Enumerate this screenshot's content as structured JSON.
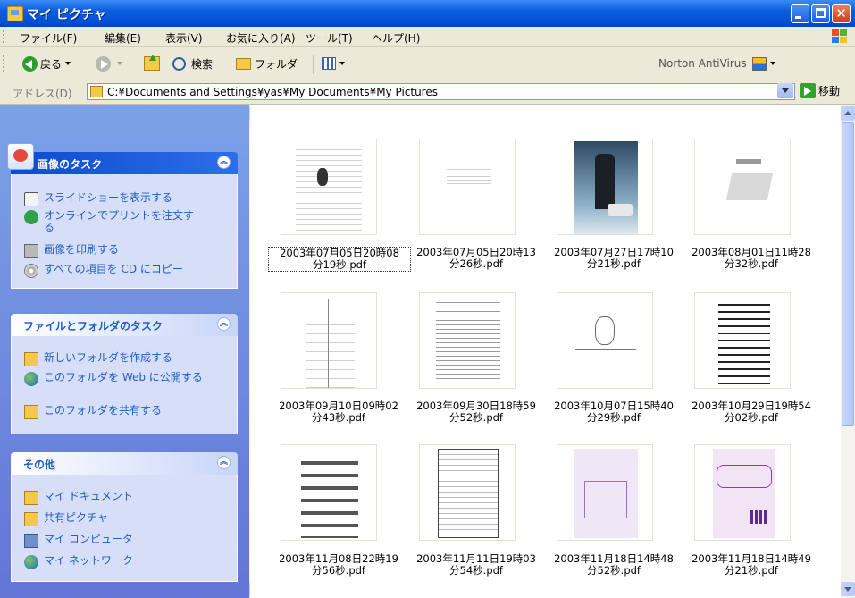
{
  "window": {
    "title": "マイ ピクチャ"
  },
  "menu": [
    "ファイル(F)",
    "編集(E)",
    "表示(V)",
    "お気に入り(A)",
    "ツール(T)",
    "ヘルプ(H)"
  ],
  "toolbar": {
    "back": "戻る",
    "search": "検索",
    "folders": "フォルダ",
    "norton": "Norton AntiVirus"
  },
  "address": {
    "label": "アドレス(D)",
    "path": "C:¥Documents and Settings¥yas¥My Documents¥My Pictures",
    "go": "移動"
  },
  "panels": [
    {
      "title": "画像のタスク",
      "items": [
        {
          "label": "スライドショーを表示する",
          "icon": "slideshow-icon"
        },
        {
          "label": "オンラインでプリントを注文する",
          "icon": "online-print-icon"
        },
        {
          "label": "画像を印刷する",
          "icon": "printer-icon"
        },
        {
          "label": "すべての項目を CD にコピー",
          "icon": "cd-icon"
        }
      ]
    },
    {
      "title": "ファイルとフォルダのタスク",
      "items": [
        {
          "label": "新しいフォルダを作成する",
          "icon": "new-folder-icon"
        },
        {
          "label": "このフォルダを Web に公開する",
          "icon": "web-publish-icon"
        },
        {
          "label": "このフォルダを共有する",
          "icon": "share-folder-icon"
        }
      ]
    },
    {
      "title": "その他",
      "items": [
        {
          "label": "マイ ドキュメント",
          "icon": "my-documents-icon"
        },
        {
          "label": "共有ピクチャ",
          "icon": "shared-pictures-icon"
        },
        {
          "label": "マイ コンピュータ",
          "icon": "my-computer-icon"
        },
        {
          "label": "マイ ネットワーク",
          "icon": "my-network-icon"
        }
      ]
    }
  ],
  "files": [
    {
      "line1": "2003年07月05日20時08",
      "line2": "分19秒.pdf",
      "selected": true,
      "kind": "form"
    },
    {
      "line1": "2003年07月05日20時13",
      "line2": "分26秒.pdf",
      "selected": false,
      "kind": "text"
    },
    {
      "line1": "2003年07月27日17時10",
      "line2": "分21秒.pdf",
      "selected": false,
      "kind": "poster"
    },
    {
      "line1": "2003年08月01日11時28",
      "line2": "分32秒.pdf",
      "selected": false,
      "kind": "scanner"
    },
    {
      "line1": "2003年09月10日09時02",
      "line2": "分43秒.pdf",
      "selected": false,
      "kind": "drawing"
    },
    {
      "line1": "2003年09月30日18時59",
      "line2": "分52秒.pdf",
      "selected": false,
      "kind": "form"
    },
    {
      "line1": "2003年10月07日15時40",
      "line2": "分29秒.pdf",
      "selected": false,
      "kind": "sketch"
    },
    {
      "line1": "2003年10月29日19時54",
      "line2": "分02秒.pdf",
      "selected": false,
      "kind": "table"
    },
    {
      "line1": "2003年11月08日22時19",
      "line2": "分56秒.pdf",
      "selected": false,
      "kind": "catalog"
    },
    {
      "line1": "2003年11月11日19時03",
      "line2": "分54秒.pdf",
      "selected": false,
      "kind": "form"
    },
    {
      "line1": "2003年11月18日14時48",
      "line2": "分52秒.pdf",
      "selected": false,
      "kind": "map"
    },
    {
      "line1": "2003年11月18日14時49",
      "line2": "分21秒.pdf",
      "selected": false,
      "kind": "flyer"
    }
  ],
  "colors": {
    "title_bar": "#0a5ee0",
    "panel_head_dark": "#215dc6",
    "panel_body": "#d6dff7",
    "task_link": "#215dc6"
  }
}
